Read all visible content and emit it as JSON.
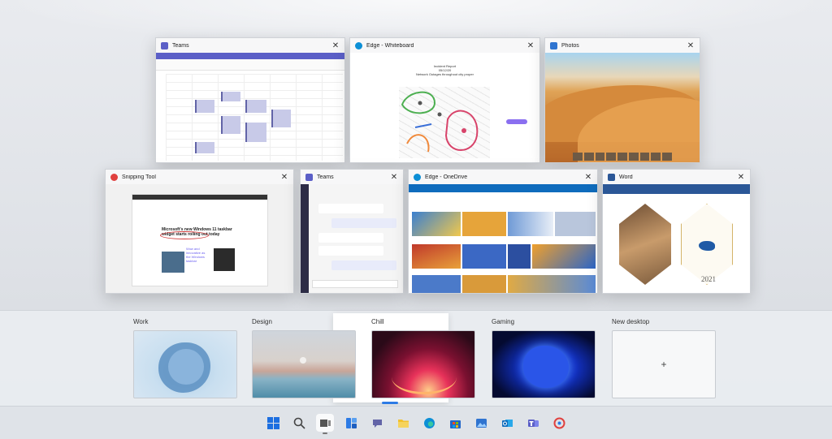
{
  "windows": {
    "teams_calendar": {
      "title": "Teams"
    },
    "edge_whiteboard": {
      "title": "Edge - Whiteboard",
      "board_text": "Incident Report\n05/12/20\nNetwork Outages throughout city proper"
    },
    "photos": {
      "title": "Photos"
    },
    "snipping_tool": {
      "title": "Snipping Tool",
      "headline": "Microsoft's new Windows 11 taskbar widget starts rolling out today",
      "note": "Wow and innovative as the Windows taskbar"
    },
    "teams_chat": {
      "title": "Teams"
    },
    "edge_onedrive": {
      "title": "Edge - OneDrive"
    },
    "word": {
      "title": "Word",
      "year": "2021"
    }
  },
  "desktops": [
    {
      "label": "Work"
    },
    {
      "label": "Design"
    },
    {
      "label": "Chill",
      "selected": true
    },
    {
      "label": "Gaming"
    },
    {
      "label": "New desktop",
      "symbol": "+"
    }
  ],
  "taskbar": [
    {
      "name": "start-icon",
      "color": "#1d6fe0"
    },
    {
      "name": "search-icon",
      "color": "#444444"
    },
    {
      "name": "task-view-icon",
      "color": "#555555",
      "active": true
    },
    {
      "name": "widgets-icon",
      "color": "#2d7be5"
    },
    {
      "name": "chat-icon",
      "color": "#6264a7"
    },
    {
      "name": "file-explorer-icon",
      "color": "#f2c12e"
    },
    {
      "name": "edge-icon",
      "color": "#0c8fd6"
    },
    {
      "name": "store-icon",
      "color": "#2166c9"
    },
    {
      "name": "photos-icon",
      "color": "#2f74d0"
    },
    {
      "name": "outlook-icon",
      "color": "#0f6cbd"
    },
    {
      "name": "teams-icon",
      "color": "#5b5fc7"
    },
    {
      "name": "snipping-tool-icon",
      "color": "#e0413f"
    }
  ],
  "colors": {
    "accent": "#2d7be5",
    "teams": "#5b5fc7",
    "edge": "#0c8fd6",
    "word": "#2b5797"
  }
}
